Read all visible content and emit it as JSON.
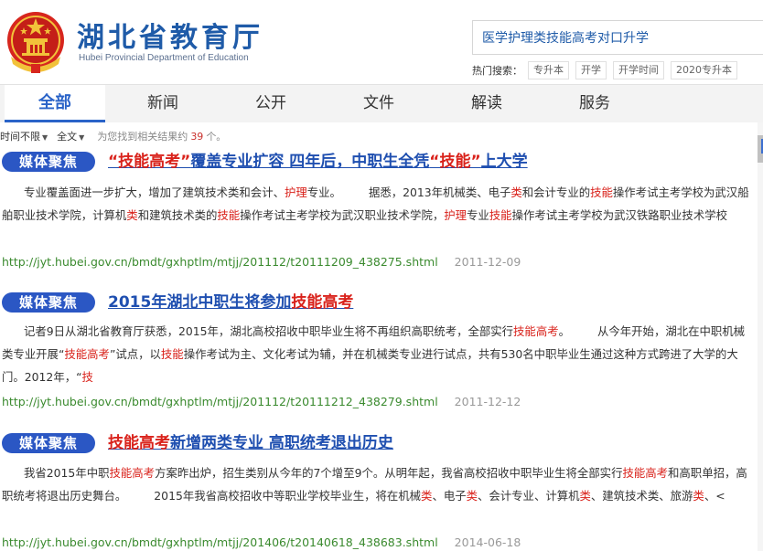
{
  "header": {
    "title": "湖北省教育厅",
    "subtitle": "Hubei Provincial Department of Education",
    "emblem_icon": "national-emblem-icon",
    "brand_color": "#1f5ba8"
  },
  "search": {
    "value": "医学护理类技能高考对口升学",
    "hot_label": "热门搜索：",
    "hot_tags": [
      "专升本",
      "开学",
      "开学时间",
      "2020专升本"
    ]
  },
  "tabs": [
    {
      "label": "全部",
      "active": true
    },
    {
      "label": "新闻",
      "active": false
    },
    {
      "label": "公开",
      "active": false
    },
    {
      "label": "文件",
      "active": false
    },
    {
      "label": "解读",
      "active": false
    },
    {
      "label": "服务",
      "active": false
    }
  ],
  "filter": {
    "time": "时间不限",
    "scope": "全文",
    "info_prefix": "为您找到相关结果约",
    "count": "39",
    "info_suffix": "个。"
  },
  "results": [
    {
      "badge": "媒体聚焦",
      "title_parts": [
        {
          "text": "“技能高考”",
          "hl": true
        },
        {
          "text": "覆盖专业扩容 四年后，中职生全凭",
          "hl": false
        },
        {
          "text": "“技能”",
          "hl": true
        },
        {
          "text": "上大学",
          "hl": false
        }
      ],
      "snippet_parts": [
        {
          "text": "专业覆盖面进一步扩大，增加了建筑技术类和会计、",
          "hl": false
        },
        {
          "text": "护理",
          "hl": true
        },
        {
          "text": "专业。",
          "hl": false
        },
        {
          "text": "据悉，2013年机械类、电子",
          "hl": false,
          "gap": true
        },
        {
          "text": "类",
          "hl": true
        },
        {
          "text": "和会计专业的",
          "hl": false
        },
        {
          "text": "技能",
          "hl": true
        },
        {
          "text": "操作考试主考学校为武汉船舶职业技术学院，计算机",
          "hl": false
        },
        {
          "text": "类",
          "hl": true
        },
        {
          "text": "和建筑技术类的",
          "hl": false
        },
        {
          "text": "技能",
          "hl": true
        },
        {
          "text": "操作考试主考学校为武汉职业技术学院，",
          "hl": false
        },
        {
          "text": "护理",
          "hl": true
        },
        {
          "text": "专业",
          "hl": false
        },
        {
          "text": "技能",
          "hl": true
        },
        {
          "text": "操作考试主考学校为武汉铁路职业技术学校",
          "hl": false
        }
      ],
      "url": "http://jyt.hubei.gov.cn/bmdt/gxhptlm/mtjj/201112/t20111209_438275.shtml",
      "date": "2011-12-09"
    },
    {
      "badge": "媒体聚焦",
      "title_parts": [
        {
          "text": "2015年湖北中职生将参加",
          "hl": false
        },
        {
          "text": "技能高考",
          "hl": true
        }
      ],
      "snippet_parts": [
        {
          "text": "记者9日从湖北省教育厅获悉，2015年，湖北高校招收中职毕业生将不再组织高职统考，全部实行",
          "hl": false
        },
        {
          "text": "技能高考",
          "hl": true
        },
        {
          "text": "。",
          "hl": false
        },
        {
          "text": "从今年开始，湖北在中职机械类专业开展“",
          "hl": false,
          "gap": true
        },
        {
          "text": "技能高考",
          "hl": true
        },
        {
          "text": "”试点，以",
          "hl": false
        },
        {
          "text": "技能",
          "hl": true
        },
        {
          "text": "操作考试为主、文化考试为辅，并在机械类专业进行试点，共有530名中职毕业生通过这种方式跨进了大学的大门。2012年，“",
          "hl": false
        },
        {
          "text": "技",
          "hl": true
        }
      ],
      "url": "http://jyt.hubei.gov.cn/bmdt/gxhptlm/mtjj/201112/t20111212_438279.shtml",
      "date": "2011-12-12"
    },
    {
      "badge": "媒体聚焦",
      "title_parts": [
        {
          "text": "技能高考",
          "hl": true
        },
        {
          "text": "新增两类专业 高职统考退出历史",
          "hl": false
        }
      ],
      "snippet_parts": [
        {
          "text": "我省2015年中职",
          "hl": false
        },
        {
          "text": "技能高考",
          "hl": true
        },
        {
          "text": "方案昨出炉，招生类别从今年的7个增至9个。从明年起，我省高校招收中职毕业生将全部实行",
          "hl": false
        },
        {
          "text": "技能高考",
          "hl": true
        },
        {
          "text": "和高职单招，高职统考将退出历史舞台。",
          "hl": false
        },
        {
          "text": "2015年我省高校招收中等职业学校毕业生，将在机械",
          "hl": false,
          "gap": true
        },
        {
          "text": "类",
          "hl": true
        },
        {
          "text": "、电子",
          "hl": false
        },
        {
          "text": "类",
          "hl": true
        },
        {
          "text": "、会计专业、计算机",
          "hl": false
        },
        {
          "text": "类",
          "hl": true
        },
        {
          "text": "、建筑技术类、旅游",
          "hl": false
        },
        {
          "text": "类",
          "hl": true
        },
        {
          "text": "、<",
          "hl": false
        }
      ],
      "url": "http://jyt.hubei.gov.cn/bmdt/gxhptlm/mtjj/201406/t20140618_438683.shtml",
      "date": "2014-06-18"
    }
  ],
  "colors": {
    "highlight": "#d9221b",
    "link": "#1f4fb0",
    "url": "#3a8a2e",
    "badge": "#2b57c4",
    "tab_active": "#2a63c8"
  }
}
